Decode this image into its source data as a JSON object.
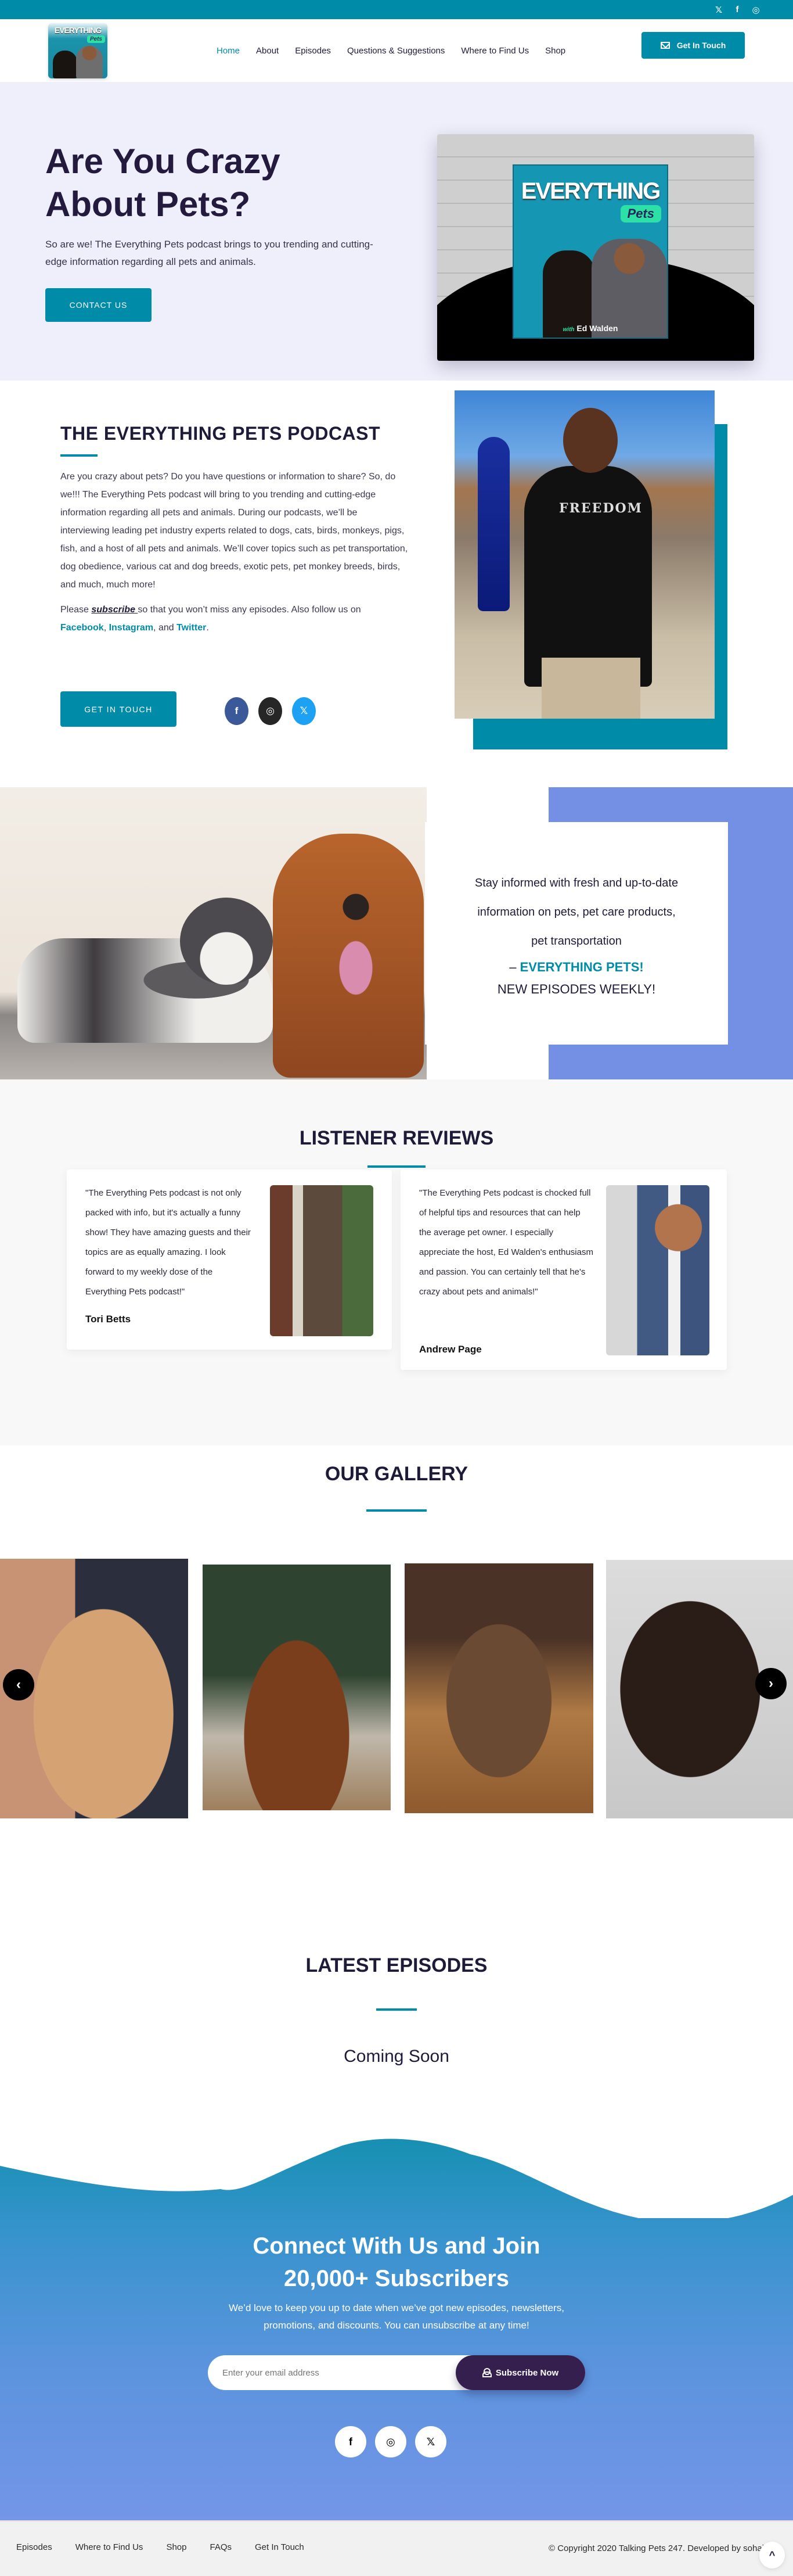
{
  "topbar": {
    "social_icons": [
      {
        "name": "twitter-icon",
        "glyph": "🐦"
      },
      {
        "name": "facebook-icon",
        "glyph": "f"
      },
      {
        "name": "instagram-icon",
        "glyph": "◎"
      }
    ]
  },
  "header": {
    "logo": {
      "line1": "EVERYTHING",
      "line2": "Pets"
    },
    "nav": [
      "Home",
      "About",
      "Episodes",
      "Questions & Suggestions",
      "Where to Find Us",
      "Shop"
    ],
    "active_nav": "Home",
    "cta_label": "Get In Touch"
  },
  "hero": {
    "title_line1": "Are You Crazy",
    "title_line2": "About Pets?",
    "subtitle": "So are we! The Everything Pets podcast brings to you trending and cutting-edge information regarding all pets and animals.",
    "button_label": "CONTACT US",
    "cover": {
      "title": "EVERYTHING",
      "badge": "Pets",
      "with": "with",
      "host": "Ed Walden"
    }
  },
  "about": {
    "title": "THE EVERYTHING PETS PODCAST",
    "paragraph1": "Are you crazy about pets? Do you have questions or information to share? So, do we!!! The Everything Pets podcast will bring to you trending and cutting-edge information regarding all pets and animals. During our podcasts, we’ll be interviewing leading pet industry experts related to dogs, cats, birds, monkeys, pigs, fish, and a host of all pets and animals.  We’ll cover topics such as pet transportation, dog obedience, various cat and dog breeds, exotic pets, pet monkey breeds, birds, and much, much more!",
    "p2_before": "Please ",
    "p2_subscribe": "subscribe ",
    "p2_middle": "so that you won’t miss any episodes. Also follow us on ",
    "p2_facebook": "Facebook",
    "p2_comma": ", ",
    "p2_instagram": "Instagram",
    "p2_and": ", and ",
    "p2_twitter": "Twitter",
    "p2_end": ".",
    "button_label": "GET IN TOUCH",
    "photo_shirt_text": "FREEDOM",
    "socials": [
      {
        "name": "facebook-icon",
        "glyph": "f",
        "color": "#3b5998"
      },
      {
        "name": "instagram-icon",
        "glyph": "◎",
        "color": "#262626"
      },
      {
        "name": "twitter-icon",
        "glyph": "🐦",
        "color": "#1da1f2"
      }
    ]
  },
  "banner": {
    "line1": "Stay informed with fresh and up-to-date",
    "line2": "information on pets, pet care products,",
    "line3": "pet transportation",
    "dash": "– ",
    "highlight": "EVERYTHING PETS!",
    "weekly": "NEW EPISODES WEEKLY!"
  },
  "reviews": {
    "title": "LISTENER REVIEWS",
    "items": [
      {
        "quote": "\"The Everything Pets podcast is not only packed with info, but it's actually a funny show! They have amazing guests and their topics are as equally amazing. I look forward to my weekly dose of the Everything Pets podcast!\"",
        "name": "Tori Betts"
      },
      {
        "quote": "\"The Everything Pets podcast is chocked full of helpful tips and resources that can help the average pet owner. I especially appreciate the host, Ed Walden's enthusiasm and passion. You can certainly tell that he's crazy about pets and animals!\"",
        "name": "Andrew Page"
      }
    ]
  },
  "gallery": {
    "title": "OUR GALLERY",
    "prev": "‹",
    "next": "›"
  },
  "episodes": {
    "title": "LATEST EPISODES",
    "status": "Coming Soon"
  },
  "subscribe": {
    "title_line1": "Connect With Us and Join",
    "title_line2": "20,000+ Subscribers",
    "text_line1": "We’d love to keep you up to date when we’ve got new episodes, newsletters,",
    "text_line2": "promotions, and discounts. You can unsubscribe at any time!",
    "email_placeholder": "Enter your email address",
    "email_value": "",
    "button_label": "Subscribe Now",
    "socials": [
      {
        "name": "facebook-icon",
        "glyph": "f"
      },
      {
        "name": "instagram-icon",
        "glyph": "◎"
      },
      {
        "name": "twitter-icon",
        "glyph": "🐦"
      }
    ]
  },
  "footer": {
    "nav": [
      "Episodes",
      "Where to Find Us",
      "Shop",
      "FAQs",
      "Get In Touch"
    ],
    "copyright": "© Copyright 2020 Talking Pets 247. Developed by sohai",
    "to_top": "^"
  },
  "colors": {
    "brand": "#008ca9",
    "dark_text": "#1e1b39",
    "banner_blue": "#7490e4",
    "subscribe_button": "#351f4f"
  }
}
